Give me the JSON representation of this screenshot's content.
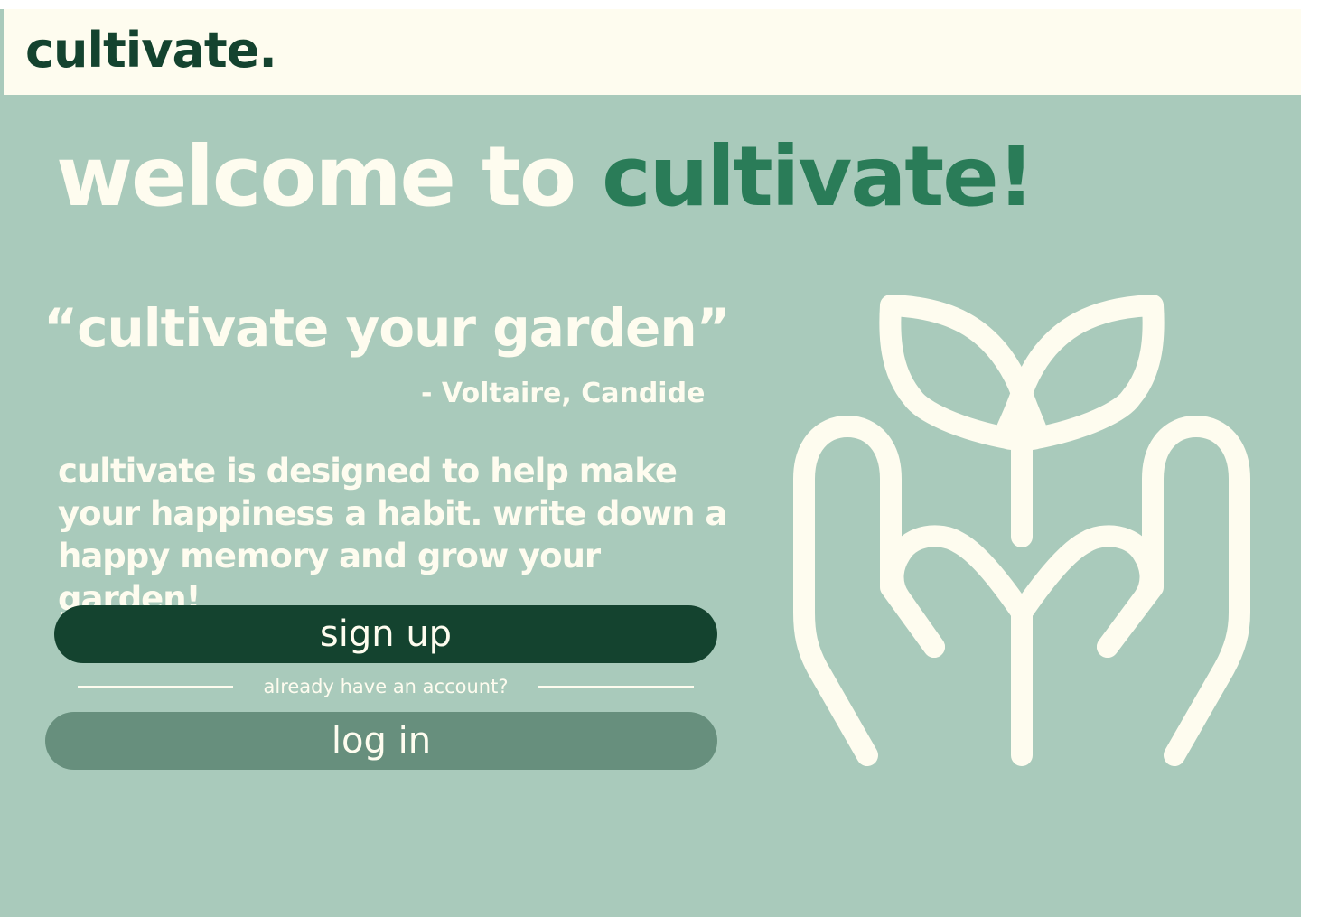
{
  "header": {
    "brand": "cultivate."
  },
  "hero": {
    "welcome_prefix": "welcome to ",
    "welcome_accent": "cultivate!",
    "quote": "“cultivate your garden”",
    "attribution": "- Voltaire, Candide",
    "description": "cultivate is designed to help make your happiness a habit. write down a happy memory and grow your garden!"
  },
  "actions": {
    "signup_label": "sign up",
    "divider_text": "already have an account?",
    "login_label": "log in"
  },
  "illustration": {
    "icon": "hands-holding-sprout-icon"
  },
  "colors": {
    "background": "#a9cabb",
    "header_background": "#fefcef",
    "brand_dark": "#14432f",
    "accent_green": "#2a7c58",
    "secondary_button": "#678f7d",
    "text_light": "#fefcef"
  }
}
